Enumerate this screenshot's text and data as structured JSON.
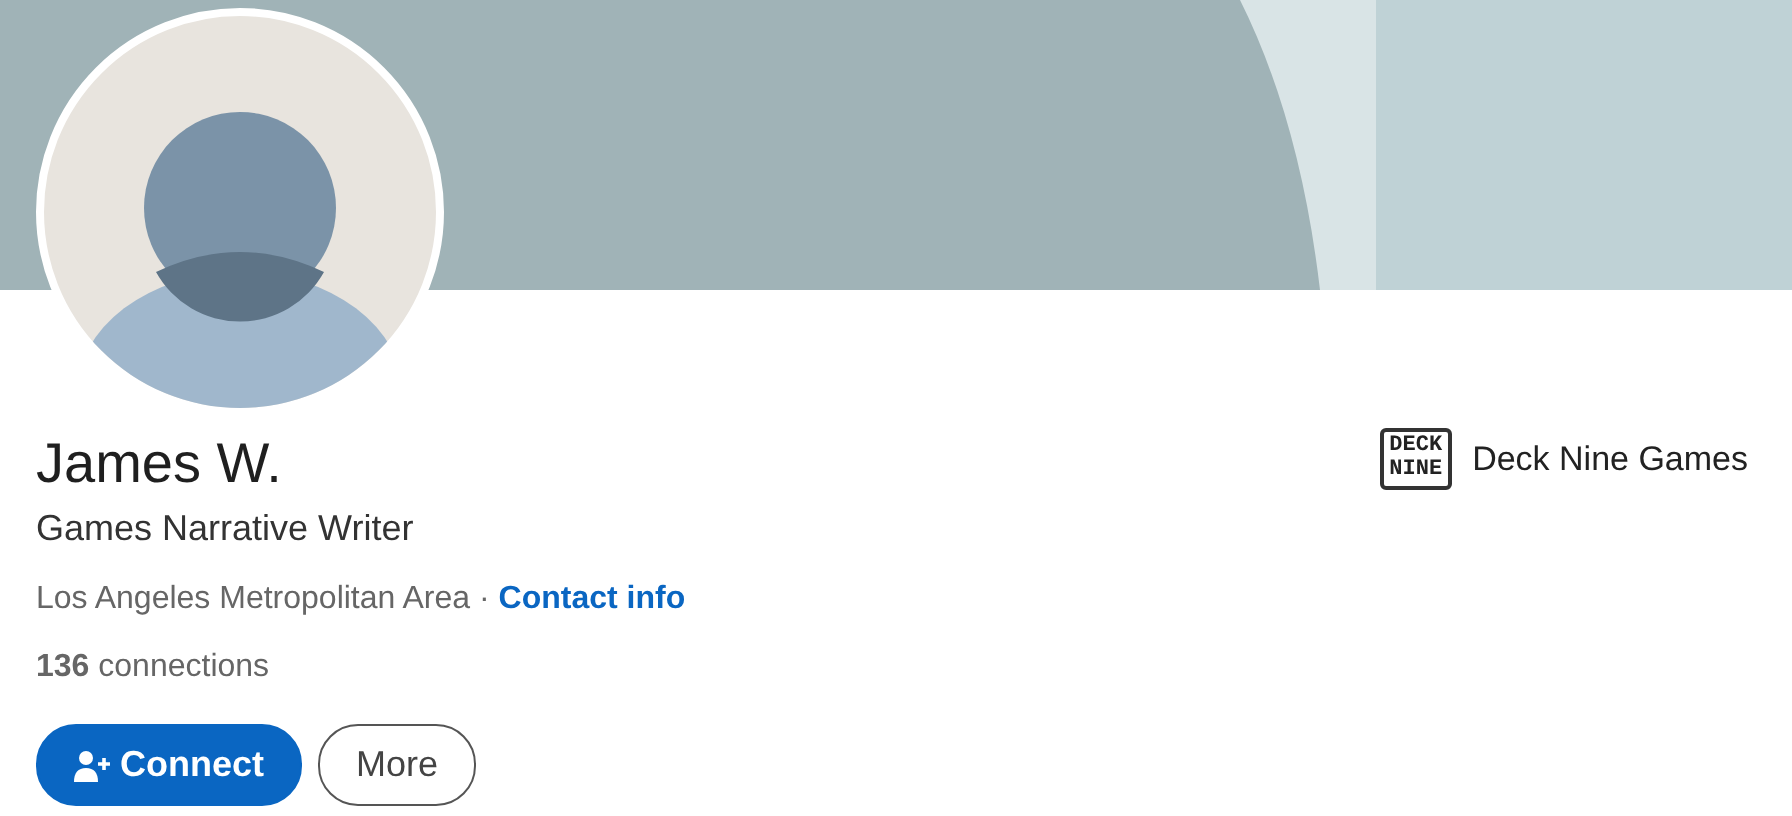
{
  "profile": {
    "name": "James W.",
    "headline": "Games Narrative Writer",
    "location": "Los Angeles Metropolitan Area",
    "separator": "·",
    "contact_link": "Contact info",
    "connections_count": "136",
    "connections_label": "connections"
  },
  "company": {
    "logo_lines": [
      "DECK",
      "NINE"
    ],
    "name": "Deck Nine Games"
  },
  "buttons": [
    {
      "kind": "primary",
      "label": "Connect"
    },
    {
      "kind": "outline",
      "label": "More"
    }
  ]
}
